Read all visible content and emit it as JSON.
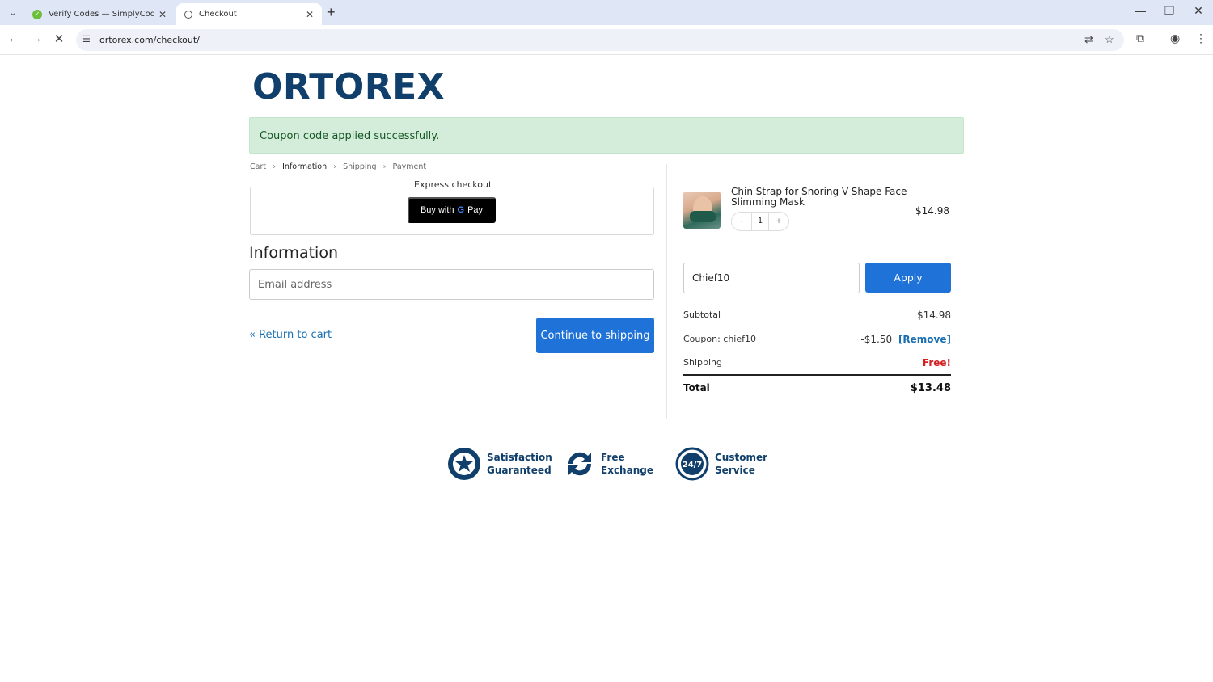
{
  "browser": {
    "tabs": [
      {
        "title": "Verify Codes — SimplyCodes",
        "active": false
      },
      {
        "title": "Checkout",
        "active": true
      }
    ],
    "url": "ortorex.com/checkout/"
  },
  "page": {
    "logo": "ORTOREX",
    "notice": "Coupon code applied successfully.",
    "breadcrumbs": [
      "Cart",
      "Information",
      "Shipping",
      "Payment"
    ],
    "express_checkout": "Express checkout",
    "gpay": {
      "prefix": "Buy with",
      "g": "G",
      "pay": "Pay"
    },
    "information_title": "Information",
    "email_placeholder": "Email address",
    "return_link": "« Return to cart",
    "continue_button": "Continue to shipping"
  },
  "order": {
    "product": {
      "name": "Chin Strap for Snoring V-Shape Face Slimming Mask",
      "price": "$14.98",
      "qty": "1",
      "minus": "-",
      "plus": "+"
    },
    "coupon_value": "Chief10",
    "apply_button": "Apply",
    "subtotal_label": "Subtotal",
    "subtotal_value": "$14.98",
    "coupon_label": "Coupon: chief10",
    "coupon_discount": "-$1.50",
    "coupon_remove": "[Remove]",
    "shipping_label": "Shipping",
    "shipping_value": "Free!",
    "total_label": "Total",
    "total_value": "$13.48"
  },
  "trust_badges": [
    {
      "line1": "Satisfaction",
      "line2": "Guaranteed",
      "icon": "star-badge-icon"
    },
    {
      "line1": "Free",
      "line2": "Exchange",
      "icon": "exchange-arrows-icon"
    },
    {
      "line1": "Customer",
      "line2": "Service",
      "icon": "support-24-7-icon"
    }
  ],
  "colors": {
    "brand": "#0f3f6a",
    "accent": "#1f72d8",
    "success_bg": "#d4edda",
    "free": "#d42020"
  }
}
